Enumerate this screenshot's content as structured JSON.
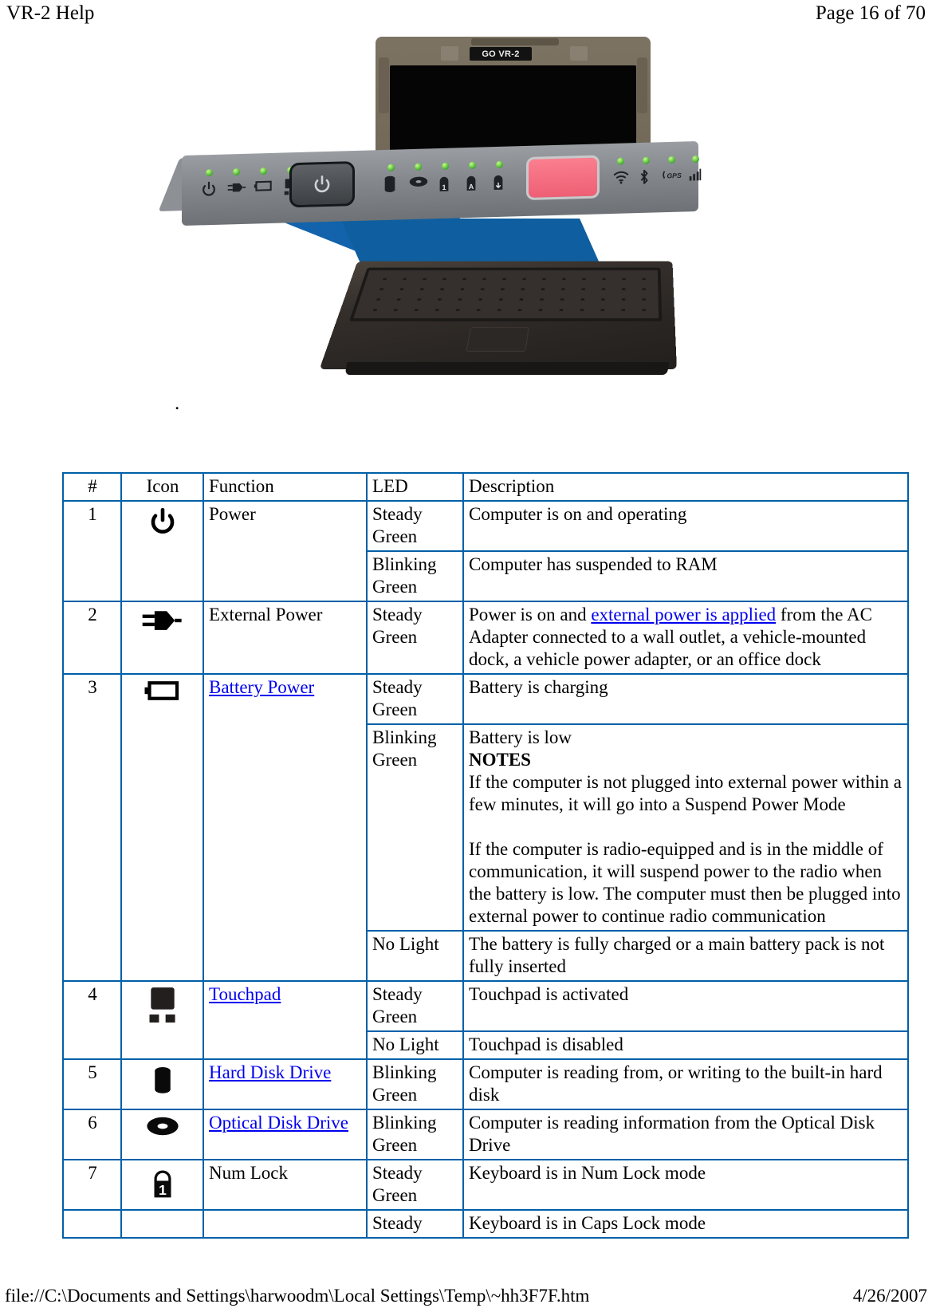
{
  "header": {
    "title": "VR-2 Help",
    "page_label": "Page 16 of 70"
  },
  "photo": {
    "alt_name": "vr-2-rugged-laptop-photo",
    "lid_badge": "GO VR-2",
    "period_mark": ".",
    "indicator_icons": [
      "power-icon",
      "external-power-icon",
      "battery-icon",
      "touchpad-icon",
      "power-button-icon",
      "hard-disk-icon",
      "optical-disk-icon",
      "num-lock-icon",
      "caps-lock-icon",
      "scroll-lock-icon",
      "programmable-button",
      "wifi-icon",
      "bluetooth-icon",
      "gps-icon",
      "signal-icon"
    ]
  },
  "table": {
    "columns": [
      "#",
      "Icon",
      "Function",
      "LED",
      "Description"
    ],
    "rows": [
      {
        "num": "1",
        "icon": "power-icon",
        "function": "Power",
        "function_is_link": false,
        "states": [
          {
            "led": "Steady Green",
            "desc": " Computer is on and operating"
          },
          {
            "led": "Blinking Green",
            "desc": " Computer has suspended to RAM"
          }
        ]
      },
      {
        "num": "2",
        "icon": "external-power-icon",
        "function": "External Power",
        "function_is_link": false,
        "states": [
          {
            "led": "Steady Green",
            "desc_pre": " Power is on and ",
            "desc_link": "external power is applied",
            "desc_post": " from the AC Adapter connected to a wall outlet, a vehicle-mounted dock, a vehicle power adapter, or an office dock"
          }
        ]
      },
      {
        "num": "3",
        "icon": "battery-icon",
        "function": "Battery Power",
        "function_is_link": true,
        "states": [
          {
            "led": "Steady Green",
            "desc": "Battery is charging"
          },
          {
            "led": "Blinking Green",
            "desc_line1": "Battery is low",
            "desc_notes_label": "NOTES",
            "desc_note1": "If the computer is not plugged into external power within a few minutes, it will go into a Suspend Power Mode",
            "desc_note2": "If the computer is radio-equipped and is in the middle of communication, it will suspend power to the radio when the battery is low.  The computer must then be plugged into external power to continue radio communication"
          },
          {
            "led": "No Light",
            "desc": "The battery is fully charged or a main battery pack is not fully inserted"
          }
        ]
      },
      {
        "num": "4",
        "icon": "touchpad-icon",
        "function": "Touchpad",
        "function_is_link": true,
        "states": [
          {
            "led": "Steady Green",
            "desc": "Touchpad is activated"
          },
          {
            "led": "No Light",
            "desc": "Touchpad is disabled"
          }
        ]
      },
      {
        "num": "5",
        "icon": "hard-disk-icon",
        "function": "Hard Disk Drive",
        "function_is_link": true,
        "states": [
          {
            "led": "Blinking Green",
            "desc": " Computer is reading from, or writing to the built-in hard disk"
          }
        ]
      },
      {
        "num": "6",
        "icon": "optical-disk-icon",
        "function": "Optical Disk Drive",
        "function_is_link": true,
        "states": [
          {
            "led": "Blinking Green",
            "desc": "Computer is reading information from the Optical Disk Drive"
          }
        ]
      },
      {
        "num": "7",
        "icon": "num-lock-icon",
        "function": "Num Lock",
        "function_is_link": false,
        "states": [
          {
            "led": "Steady Green",
            "desc": "Keyboard is in Num Lock mode"
          }
        ]
      },
      {
        "num": "",
        "icon": "",
        "function": "",
        "function_is_link": false,
        "states": [
          {
            "led": "Steady",
            "desc": "Keyboard is in Caps Lock mode"
          }
        ]
      }
    ]
  },
  "footer": {
    "path": "file://C:\\Documents and Settings\\harwoodm\\Local Settings\\Temp\\~hh3F7F.htm",
    "date": "4/26/2007"
  },
  "colors": {
    "table_border": "#0060a8",
    "link": "#0000ee",
    "led_green": "#3fa92d",
    "accent_blue": "#1263ab",
    "button_pink": "#f76e82"
  }
}
